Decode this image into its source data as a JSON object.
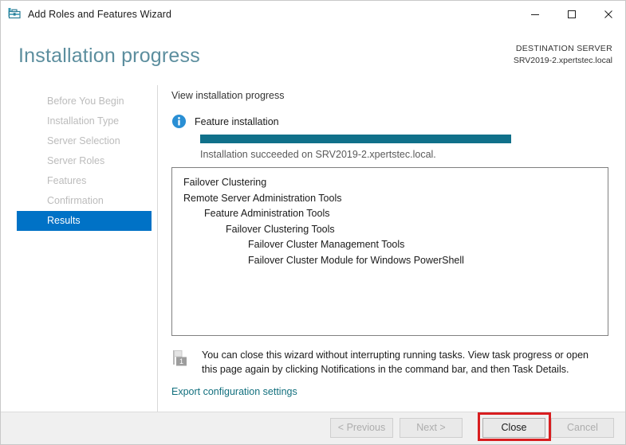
{
  "window": {
    "title": "Add Roles and Features Wizard",
    "app_icon": "toolbox-icon",
    "controls": {
      "minimize": "Minimize",
      "maximize": "Maximize",
      "close": "Close"
    }
  },
  "header": {
    "page_title": "Installation progress",
    "destination_label": "DESTINATION SERVER",
    "destination_server": "SRV2019-2.xpertstec.local"
  },
  "sidebar": {
    "items": [
      {
        "label": "Before You Begin",
        "active": false
      },
      {
        "label": "Installation Type",
        "active": false
      },
      {
        "label": "Server Selection",
        "active": false
      },
      {
        "label": "Server Roles",
        "active": false
      },
      {
        "label": "Features",
        "active": false
      },
      {
        "label": "Confirmation",
        "active": false
      },
      {
        "label": "Results",
        "active": true
      }
    ]
  },
  "main": {
    "heading": "View installation progress",
    "info_icon": "info-circle-icon",
    "feature_label": "Feature installation",
    "progress_percent": 100,
    "progress_color": "#10708a",
    "status_text": "Installation succeeded on SRV2019-2.xpertstec.local.",
    "results": [
      {
        "text": "Failover Clustering",
        "indent": 0
      },
      {
        "text": "Remote Server Administration Tools",
        "indent": 0
      },
      {
        "text": "Feature Administration Tools",
        "indent": 1
      },
      {
        "text": "Failover Clustering Tools",
        "indent": 2
      },
      {
        "text": "Failover Cluster Management Tools",
        "indent": 3
      },
      {
        "text": "Failover Cluster Module for Windows PowerShell",
        "indent": 3
      }
    ],
    "note_icon": "notification-flag-icon",
    "note_badge": "1",
    "note_text": "You can close this wizard without interrupting running tasks. View task progress or open this page again by clicking Notifications in the command bar, and then Task Details.",
    "export_link": "Export configuration settings"
  },
  "footer": {
    "buttons": [
      {
        "id": "previous",
        "label": "< Previous",
        "enabled": false
      },
      {
        "id": "next",
        "label": "Next >",
        "enabled": false
      },
      {
        "id": "close",
        "label": "Close",
        "enabled": true
      },
      {
        "id": "cancel",
        "label": "Cancel",
        "enabled": false
      }
    ]
  },
  "annotation": {
    "highlight_color": "#d81e20",
    "highlight_target": "close-button"
  }
}
